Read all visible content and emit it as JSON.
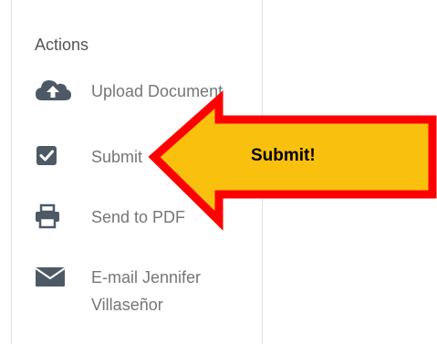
{
  "actions": {
    "title": "Actions",
    "items": [
      {
        "label": "Upload Document",
        "icon": "cloud-upload-icon"
      },
      {
        "label": "Submit",
        "icon": "checkbox-checked-icon"
      },
      {
        "label": "Send to PDF",
        "icon": "printer-icon"
      },
      {
        "label": "E-mail Jennifer Villaseñor",
        "icon": "envelope-icon"
      }
    ]
  },
  "callout": {
    "text": "Submit!",
    "fill_color": "#f9c10e",
    "border_color": "#ff0000"
  },
  "colors": {
    "icon": "#4d5a66",
    "label": "#767676"
  }
}
